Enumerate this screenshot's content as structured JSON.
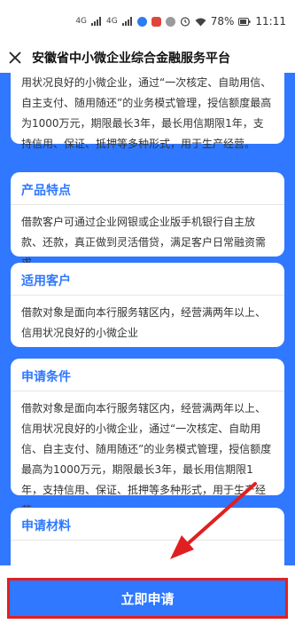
{
  "status_bar": {
    "battery": "78%",
    "time": "11:11",
    "signal1": "4G",
    "signal2": "4G"
  },
  "header": {
    "title": "安徽省中小微企业综合金融服务平台"
  },
  "cards": {
    "top_partial": {
      "text": "用状况良好的小微企业，通过“一次核定、自助用信、自主支付、随用随还”的业务模式管理，授信额度最高为1000万元，期限最长3年，最长用信期限1年，支持信用、保证、抵押等多种形式，用于生产经营。"
    },
    "features": {
      "title": "产品特点",
      "text": "借款客户可通过企业网银或企业版手机银行自主放款、还款，真正做到灵活借贷，满足客户日常融资需求。"
    },
    "customers": {
      "title": "适用客户",
      "text": "借款对象是面向本行服务辖区内，经营满两年以上、信用状况良好的小微企业"
    },
    "conditions": {
      "title": "申请条件",
      "text": "借款对象是面向本行服务辖区内，经营满两年以上、信用状况良好的小微企业，通过“一次核定、自助用信、自主支付、随用随还”的业务模式管理，授信额度最高为1000万元，期限最长3年，最长用信期限1年，支持信用、保证、抵押等多种形式，用于生产经营。"
    },
    "materials": {
      "title": "申请材料"
    }
  },
  "action": {
    "apply_label": "立即申请"
  },
  "colors": {
    "accent": "#2f78ff",
    "highlight": "#e02020"
  },
  "icons": {
    "close": "close-icon",
    "wifi": "wifi-icon",
    "alarm": "alarm-icon",
    "battery": "battery-icon"
  }
}
